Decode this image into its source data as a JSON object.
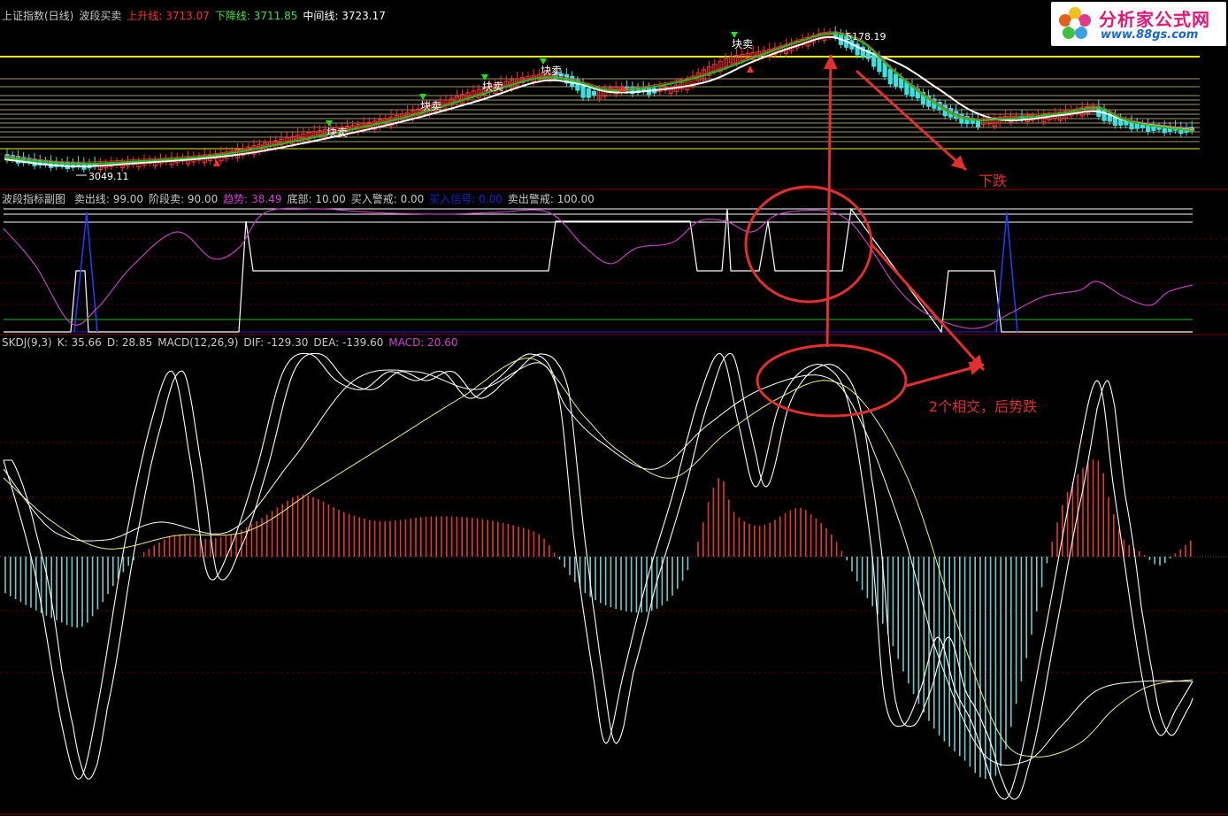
{
  "price_panel": {
    "name": "上证指数(日线)",
    "indicator": "波段买卖",
    "up_label": "上升线:",
    "up_value": "3713.07",
    "down_label": "下降线:",
    "down_value": "3711.85",
    "mid_label": "中间线:",
    "mid_value": "3723.17",
    "high_label": "5178.19",
    "low_label": "3049.11",
    "sell_signal": "块卖"
  },
  "wave_panel": {
    "title": "波段指标副图",
    "items": [
      {
        "label": "卖出线: 99.00",
        "color": "#c8c8c8"
      },
      {
        "label": "阶段卖: 90.00",
        "color": "#c8c8c8"
      },
      {
        "label": "趋势: 38.49",
        "color": "#d040d0"
      },
      {
        "label": "底部: 10.00",
        "color": "#c8c8c8"
      },
      {
        "label": "买入警戒: 0.00",
        "color": "#c8c8c8"
      },
      {
        "label": "买入信号: 0.00",
        "color": "#2020d0"
      },
      {
        "label": "卖出警戒: 100.00",
        "color": "#c8c8c8"
      }
    ]
  },
  "macd_panel": {
    "items": [
      {
        "label": "SKDJ(9,3)",
        "color": "#c8c8c8"
      },
      {
        "label": "K: 35.66",
        "color": "#c8c8c8"
      },
      {
        "label": "D: 28.85",
        "color": "#c8c8c8"
      },
      {
        "label": "MACD(12,26,9)",
        "color": "#c8c8c8"
      },
      {
        "label": "DIF: -129.30",
        "color": "#c8c8c8"
      },
      {
        "label": "DEA: -139.60",
        "color": "#c8c8c8"
      },
      {
        "label": "MACD: 20.60",
        "color": "#d040d0"
      }
    ]
  },
  "annotations": {
    "fall": "下跌",
    "cross": "2个相交，后势跌"
  },
  "logo": {
    "name": "分析家公式网",
    "url": "www.88gs.com"
  },
  "colors": {
    "up": "#ff3030",
    "down": "#40e0e0",
    "white": "#ffffff",
    "yellow": "#f0f060",
    "green": "#20c020",
    "magenta": "#c040c0",
    "blue": "#2020e0",
    "annot": "#e03030"
  },
  "chart_data": [
    {
      "type": "line",
      "title": "上证指数(日线) 波段买卖",
      "series": [
        {
          "name": "上升线",
          "values": [
            3713.07
          ]
        },
        {
          "name": "下降线",
          "values": [
            3711.85
          ]
        },
        {
          "name": "中间线",
          "values": [
            3723.17
          ]
        }
      ],
      "annotations": [
        "5178.19",
        "3049.11",
        "块卖"
      ]
    },
    {
      "type": "line",
      "title": "波段指标副图",
      "series": [
        {
          "name": "卖出线",
          "values": [
            99.0
          ]
        },
        {
          "name": "阶段卖",
          "values": [
            90.0
          ]
        },
        {
          "name": "趋势",
          "values": [
            38.49
          ]
        },
        {
          "name": "底部",
          "values": [
            10.0
          ]
        },
        {
          "name": "买入警戒",
          "values": [
            0.0
          ]
        },
        {
          "name": "买入信号",
          "values": [
            0.0
          ]
        },
        {
          "name": "卖出警戒",
          "values": [
            100.0
          ]
        }
      ]
    },
    {
      "type": "line",
      "title": "SKDJ(9,3) MACD(12,26,9)",
      "series": [
        {
          "name": "K",
          "values": [
            35.66
          ]
        },
        {
          "name": "D",
          "values": [
            28.85
          ]
        },
        {
          "name": "DIF",
          "values": [
            -129.3
          ]
        },
        {
          "name": "DEA",
          "values": [
            -139.6
          ]
        },
        {
          "name": "MACD",
          "values": [
            20.6
          ]
        }
      ]
    }
  ]
}
